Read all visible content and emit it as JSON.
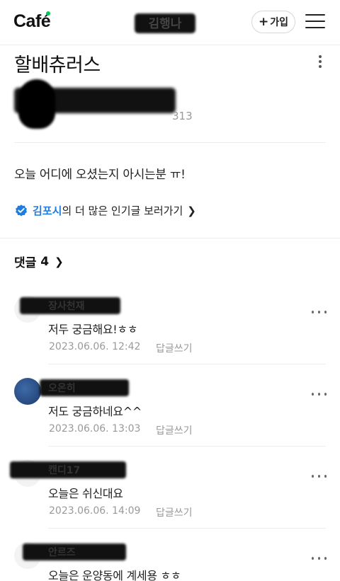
{
  "header": {
    "logo": "Café",
    "cafe_name": "김행나",
    "join_label": "가입",
    "join_plus": "+"
  },
  "post": {
    "title": "할배츄러스",
    "meta_count": "313",
    "body": "오늘 어디에 오셨는지 아시는분 ㅠ!",
    "popular_region": "김포시",
    "popular_suffix": "의 더 많은 인기글 보러가기"
  },
  "comments_section": {
    "label": "댓글",
    "count": "4"
  },
  "comments": [
    {
      "name": "장사천재",
      "text": "저두 궁금해요!ㅎㅎ",
      "date": "2023.06.06. 12:42",
      "reply": "답글쓰기"
    },
    {
      "name": "오온히",
      "text": "저도 궁금하네요^^",
      "date": "2023.06.06. 13:03",
      "reply": "답글쓰기"
    },
    {
      "name": "캔디17",
      "text": "오늘은 쉬신대요",
      "date": "2023.06.06. 14:09",
      "reply": "답글쓰기"
    },
    {
      "name": "안르즈",
      "text": "오늘은 운양동에 계세용 ㅎㅎ",
      "date": "",
      "reply": ""
    }
  ],
  "icons": {
    "verified": "verified-check-icon",
    "menu": "hamburger-menu-icon",
    "more": "more-icon"
  },
  "colors": {
    "brand_green": "#03c75a",
    "link_blue": "#1e7de0",
    "muted": "#999999"
  }
}
